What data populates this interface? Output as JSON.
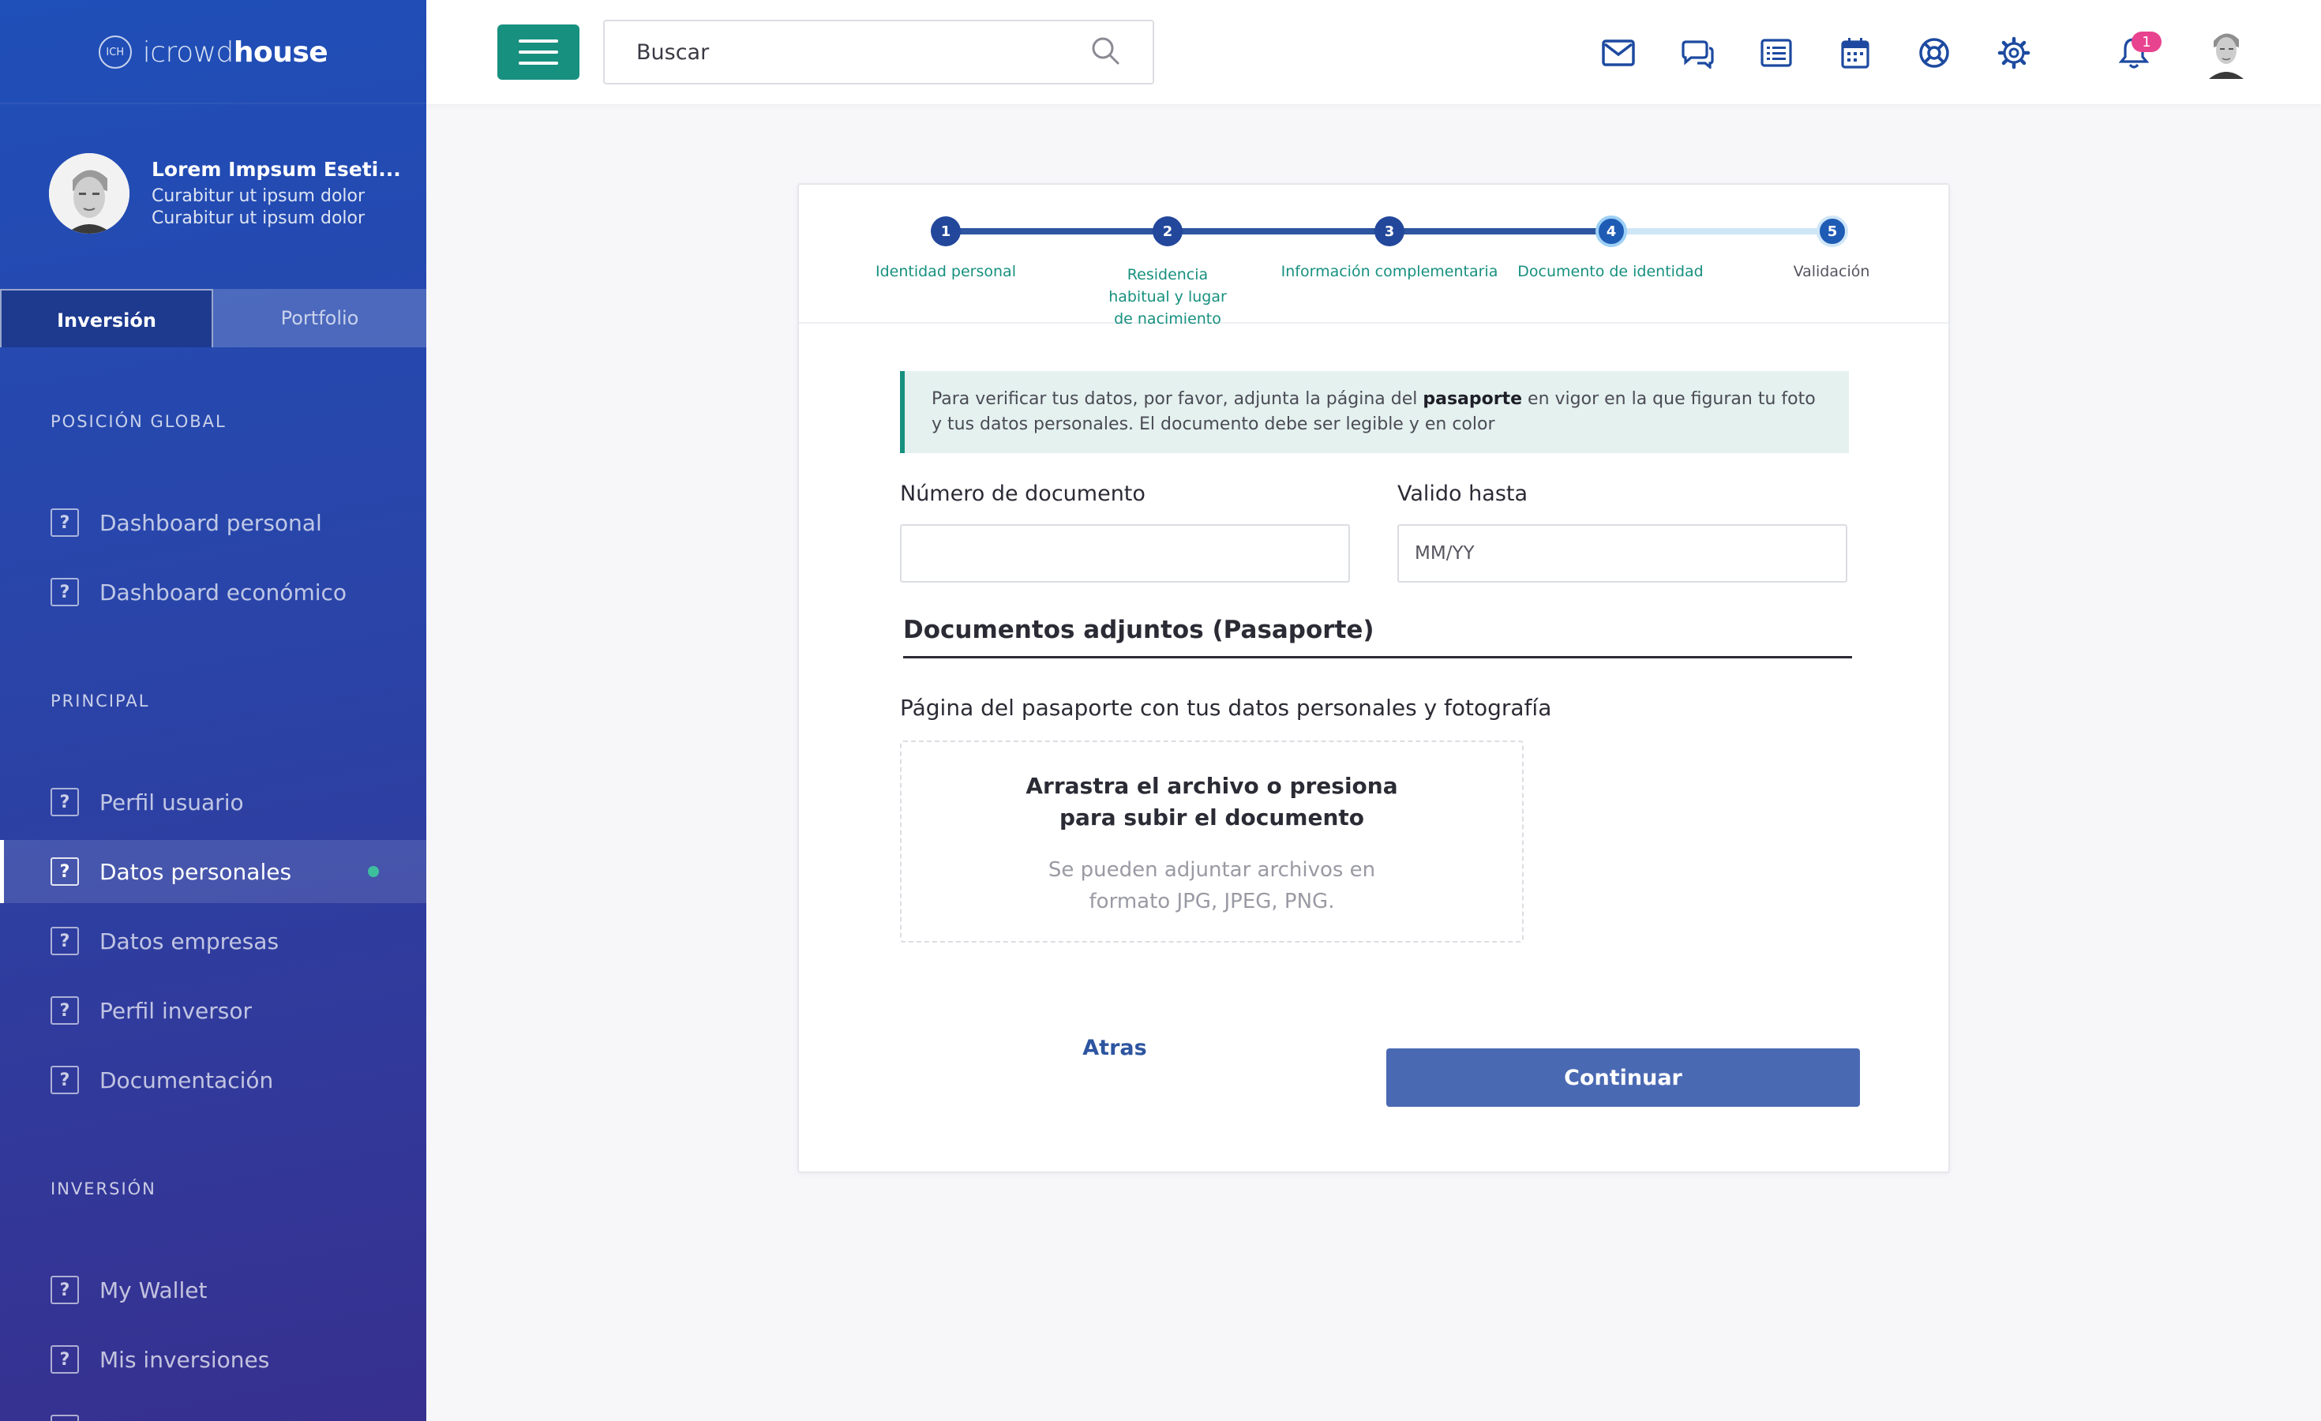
{
  "logo": {
    "mark": "ICH",
    "text_thin": "icrowd",
    "text_bold": "house"
  },
  "profile": {
    "name": "Lorem Impsum Eseti...",
    "line1": "Curabitur ut ipsum dolor",
    "line2": "Curabitur ut ipsum dolor"
  },
  "sidebar_tabs": [
    {
      "label": "Inversión",
      "active": true
    },
    {
      "label": "Portfolio",
      "active": false
    }
  ],
  "sections": {
    "global": "POSICIÓN GLOBAL",
    "principal": "PRINCIPAL",
    "inversion": "INVERSIÓN"
  },
  "nav": {
    "global": [
      "Dashboard personal",
      "Dashboard económico"
    ],
    "principal": [
      "Perfil usuario",
      "Datos personales",
      "Datos empresas",
      "Perfil inversor",
      "Documentación"
    ],
    "inversion": [
      "My Wallet",
      "Mis inversiones"
    ],
    "active_item": "Datos personales",
    "nav_icon_glyph": "?"
  },
  "topbar": {
    "search_placeholder": "Buscar",
    "icons": [
      "mail-icon",
      "chat-icon",
      "list-icon",
      "calendar-icon",
      "lifebuoy-icon",
      "gear-icon",
      "bell-icon"
    ],
    "notification_count": "1"
  },
  "stepper": {
    "steps": [
      {
        "number": "1",
        "label": "Identidad personal",
        "state": "done"
      },
      {
        "number": "2",
        "label": "Residencia habitual y lugar de nacimiento",
        "state": "done"
      },
      {
        "number": "3",
        "label": "Información complementaria",
        "state": "done"
      },
      {
        "number": "4",
        "label": "Documento de identidad",
        "state": "current"
      },
      {
        "number": "5",
        "label": "Validación",
        "state": "todo"
      }
    ]
  },
  "form": {
    "info_pre": "Para verificar tus datos, por favor, adjunta la página del ",
    "info_bold": "pasaporte",
    "info_post": " en vigor en la que figuran tu foto y tus datos personales. El documento debe ser legible y en color",
    "doc_number_label": "Número de documento",
    "doc_number_value": "",
    "valid_until_label": "Valido hasta",
    "valid_until_placeholder": "MM/YY",
    "attachments_title": "Documentos adjuntos (Pasaporte)",
    "upload_label": "Página del pasaporte con tus datos personales y fotografía",
    "drop_main": "Arrastra el archivo o presiona\npara subir el documento",
    "drop_sub": "Se pueden adjuntar archivos en\nformato JPG, JPEG, PNG.",
    "back_label": "Atras",
    "continue_label": "Continuar"
  },
  "colors": {
    "sidebar_top": "#1f4fb8",
    "sidebar_bottom": "#37308f",
    "teal": "#17907f",
    "primary_button": "#4a69b3",
    "step_done": "#2d55a0",
    "step_todo": "#cfe6f7",
    "badge": "#e8438f"
  }
}
